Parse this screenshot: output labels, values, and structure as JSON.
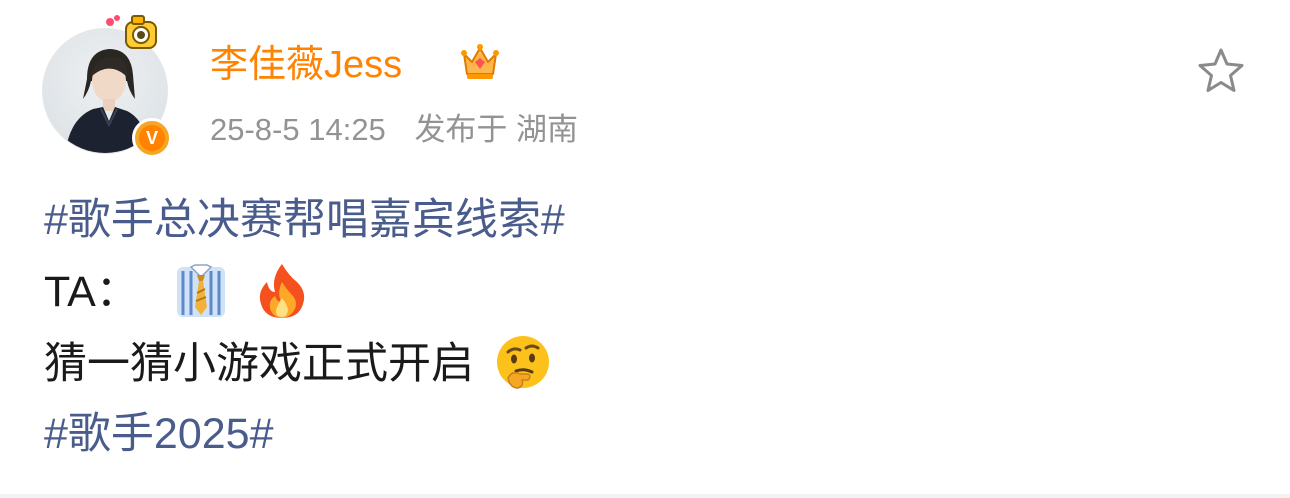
{
  "user": {
    "name": "李佳薇Jess",
    "verified_badge": "V"
  },
  "meta": {
    "time": "25-8-5 14:25",
    "location": "发布于 湖南"
  },
  "post": {
    "topic1": "#歌手总决赛帮唱嘉宾线索#",
    "line2_text": "TA：",
    "line2_emojis": [
      "necktie-emoji",
      "fire-emoji"
    ],
    "line3_text": "猜一猜小游戏正式开启",
    "line3_emoji": "thinking-face-emoji",
    "topic2": "#歌手2025#"
  },
  "colors": {
    "username": "#ff8200",
    "meta": "#939393",
    "topic": "#4a5c8c",
    "text": "#1a1a1a"
  },
  "icons": {
    "favorite": "star-icon",
    "vip": "crown-icon",
    "verified": "verified-v-icon",
    "avatar_decoration": "camera-decoration-icon"
  }
}
